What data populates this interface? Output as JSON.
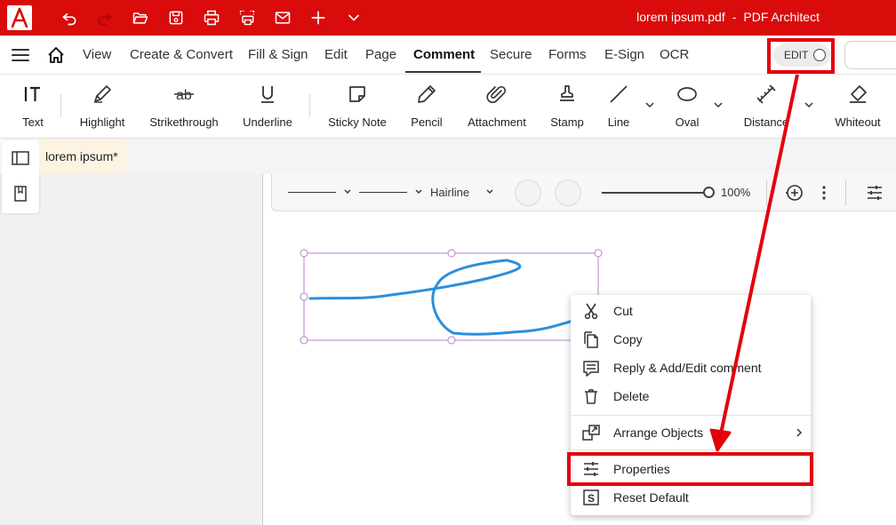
{
  "window": {
    "file_name": "lorem ipsum.pdf",
    "separator": "-",
    "app_name": "PDF Architect"
  },
  "quick_access": [
    "undo-icon",
    "redo-icon",
    "open-folder-icon",
    "save-icon",
    "print-icon",
    "scan-print-icon",
    "mail-icon",
    "plus-icon",
    "chevron-down-icon"
  ],
  "menu": {
    "items": [
      "View",
      "Create & Convert",
      "Fill & Sign",
      "Edit",
      "Page",
      "Comment",
      "Secure",
      "Forms",
      "E-Sign",
      "OCR"
    ],
    "active": "Comment",
    "edit_toggle_label": "EDIT"
  },
  "ribbon": {
    "tools": [
      {
        "label": "Text",
        "icon": "text-tool-icon"
      },
      {
        "label": "Highlight",
        "icon": "highlighter-icon"
      },
      {
        "label": "Strikethrough",
        "icon": "strikethrough-icon"
      },
      {
        "label": "Underline",
        "icon": "underline-icon"
      },
      {
        "label": "Sticky Note",
        "icon": "sticky-note-icon"
      },
      {
        "label": "Pencil",
        "icon": "pencil-icon"
      },
      {
        "label": "Attachment",
        "icon": "paperclip-icon"
      },
      {
        "label": "Stamp",
        "icon": "stamp-icon"
      },
      {
        "label": "Line",
        "icon": "line-icon"
      },
      {
        "label": "Oval",
        "icon": "oval-icon"
      },
      {
        "label": "Distance",
        "icon": "distance-icon"
      },
      {
        "label": "Whiteout",
        "icon": "eraser-icon"
      }
    ]
  },
  "document": {
    "tab_label": "lorem ipsum",
    "tab_modified": "*"
  },
  "annotation_toolbar": {
    "line_style": "Hairline",
    "opacity": "100%"
  },
  "context_menu": {
    "items": [
      {
        "label": "Cut",
        "icon": "scissors-icon"
      },
      {
        "label": "Copy",
        "icon": "copy-icon"
      },
      {
        "label": "Reply & Add/Edit comment",
        "icon": "comment-icon"
      },
      {
        "label": "Delete",
        "icon": "trash-icon"
      },
      {
        "label": "Arrange Objects",
        "icon": "arrange-icon",
        "has_submenu": true
      },
      {
        "label": "Properties",
        "icon": "sliders-icon"
      },
      {
        "label": "Reset Default",
        "icon": "reset-icon"
      }
    ]
  },
  "colors": {
    "brand_red": "#d90b0b",
    "callout_red": "#e3000b",
    "ink_blue": "#2b8fdc",
    "selection_purple": "#b77fd1"
  }
}
